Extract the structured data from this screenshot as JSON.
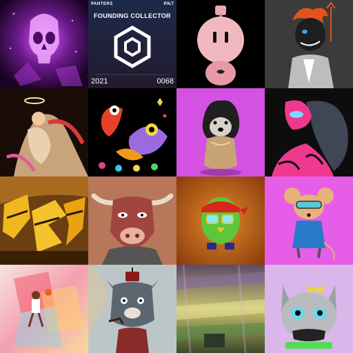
{
  "gallery": {
    "tiles": [
      {
        "icon": "crystal-skull",
        "bg": "#2b0a3d"
      },
      {
        "icon": "founding-collector-badge",
        "bg": "#1a2540",
        "brand_left": "PANTERS",
        "brand_right": "P.N.T",
        "title": "FOUNDING COLLECTOR",
        "year": "2021",
        "number": "0068"
      },
      {
        "icon": "pink-robot-character",
        "bg": "#000000"
      },
      {
        "icon": "red-haired-demon",
        "bg": "#3a3a3a"
      },
      {
        "icon": "angel-reclining-figure",
        "bg": "#1a0f0a"
      },
      {
        "icon": "cartoon-birds",
        "bg": "#000000"
      },
      {
        "icon": "husky-dog-3d",
        "bg": "#d24fe0"
      },
      {
        "icon": "pink-masked-creature",
        "bg": "#111111"
      },
      {
        "icon": "graffiti-letters",
        "bg": "#6b3e10"
      },
      {
        "icon": "bull-character",
        "bg": "#b8745a"
      },
      {
        "icon": "green-bird-bandana",
        "bg": "#c6701b"
      },
      {
        "icon": "mouse-character",
        "bg": "#e75ce8"
      },
      {
        "icon": "basketball-player-collage",
        "bg": "#f3d8d8"
      },
      {
        "icon": "bulldog-smoking-pipe",
        "bg": "#b9c4c8"
      },
      {
        "icon": "abstract-glitch-landscape",
        "bg": "#4a3a2a"
      },
      {
        "icon": "gray-cat-bow",
        "bg": "#d9b5ea"
      }
    ]
  }
}
